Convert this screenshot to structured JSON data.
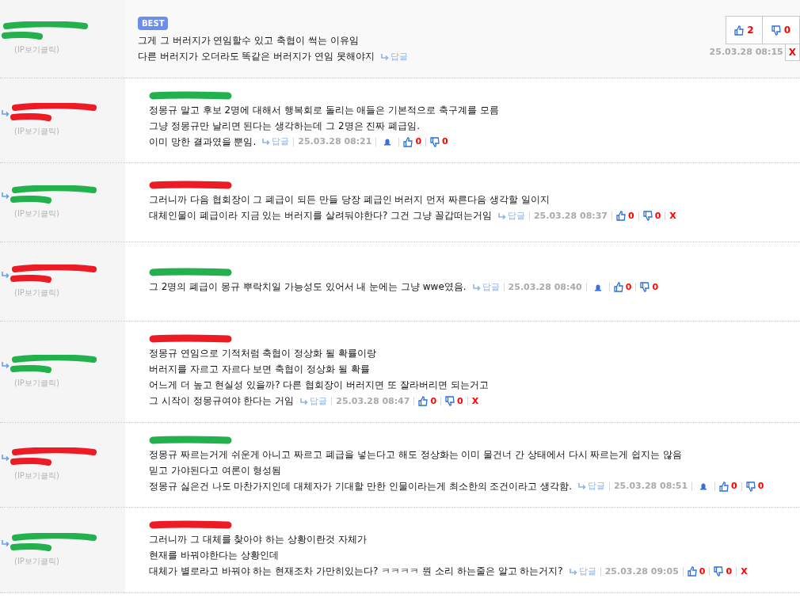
{
  "comments": [
    {
      "kind": "best",
      "reply": false,
      "badge": "BEST",
      "name_redaction": {
        "color": "#22b14c"
      },
      "ip_hint": "(IP보기클릭)",
      "lines": [
        "그게 그 버러지가 연임할수 있고 축협이 썩는 이유임",
        "다른 버러지가 오더라도 똑같은 버러지가 연임 못해야지"
      ],
      "reply_link": "답글",
      "time": "25.03.28 08:15",
      "report": false,
      "likes": "2",
      "dislikes": "0",
      "delete": "X"
    },
    {
      "kind": "normal",
      "reply": true,
      "name_redaction": {
        "color": "#ed1c24"
      },
      "body_redaction": {
        "color": "#22b14c"
      },
      "ip_hint": "(IP보기클릭)",
      "lines": [
        "정몽규 말고 후보 2명에 대해서 행복회로 돌리는 애들은 기본적으로 축구계를 모름",
        "그냥 정몽규만 날리면 된다는 생각하는데 그 2명은 진짜 폐급임.",
        "이미 망한 결과였을 뿐임."
      ],
      "reply_link": "답글",
      "time": "25.03.28 08:21",
      "report": true,
      "likes": "0",
      "dislikes": "0"
    },
    {
      "kind": "normal",
      "reply": true,
      "name_redaction": {
        "color": "#22b14c"
      },
      "body_redaction": {
        "color": "#ed1c24"
      },
      "ip_hint": "(IP보기클릭)",
      "lines": [
        "그러니까 다음 협회장이 그 폐급이 되든 만들 당장 폐급인 버러지 먼저 짜른다음 생각할 일이지",
        "대체인물이 폐급이라 지금 있는 버러지를 살려둬야한다? 그건 그냥 꼴갑떠는거임"
      ],
      "reply_link": "답글",
      "time": "25.03.28 08:37",
      "report": false,
      "likes": "0",
      "dislikes": "0",
      "delete": "X"
    },
    {
      "kind": "normal",
      "reply": true,
      "name_redaction": {
        "color": "#ed1c24"
      },
      "body_redaction": {
        "color": "#22b14c"
      },
      "ip_hint": "(IP보기클릭)",
      "lines": [
        "그 2명의 폐급이 몽규 뿌락치일 가능성도 있어서 내 눈에는 그냥 wwe였음."
      ],
      "reply_link": "답글",
      "time": "25.03.28 08:40",
      "report": true,
      "likes": "0",
      "dislikes": "0"
    },
    {
      "kind": "normal",
      "reply": true,
      "name_redaction": {
        "color": "#22b14c"
      },
      "body_redaction": {
        "color": "#ed1c24"
      },
      "ip_hint": "(IP보기클릭)",
      "lines": [
        "정몽규 연임으로 기적처럼 축협이 정상화 될 확률이랑",
        "버러지를 자르고 자르다 보면 축협이 정상화 될 확률",
        "어느게 더 높고 현실성 있을까? 다른 협회장이 버러지면 또 잘라버리면 되는거고",
        "그 시작이 정몽규여야 한다는 거임"
      ],
      "reply_link": "답글",
      "time": "25.03.28 08:47",
      "report": false,
      "likes": "0",
      "dislikes": "0",
      "delete": "X"
    },
    {
      "kind": "normal",
      "reply": true,
      "name_redaction": {
        "color": "#ed1c24"
      },
      "body_redaction": {
        "color": "#22b14c"
      },
      "ip_hint": "(IP보기클릭)",
      "lines": [
        "정몽규 짜르는거게 쉬운게 아니고 짜르고 폐급을 넣는다고 해도 정상화는 이미 물건너 간 상태에서 다시 짜르는게 쉽지는 않음",
        "믿고 가야된다고 여론이 형성됨",
        "정몽규 싫은건 나도 마찬가지인데 대체자가 기대할 만한 인물이라는게 최소한의 조건이라고 생각함."
      ],
      "reply_link": "답글",
      "time": "25.03.28 08:51",
      "report": true,
      "likes": "0",
      "dislikes": "0"
    },
    {
      "kind": "normal",
      "reply": true,
      "name_redaction": {
        "color": "#22b14c"
      },
      "body_redaction": {
        "color": "#ed1c24"
      },
      "ip_hint": "(IP보기클릭)",
      "lines": [
        "그러니까 그 대체를 찾아야 하는 상황이란것 자체가",
        "현재를 바꿔야한다는 상황인데",
        "대체가 별로라고 바꿔야 하는 현재조차 가만히있는다? ㅋㅋㅋㅋ 뭔 소리 하는줄은 알고 하는거지?"
      ],
      "reply_link": "답글",
      "time": "25.03.28 09:05",
      "report": false,
      "likes": "0",
      "dislikes": "0",
      "delete": "X"
    }
  ]
}
